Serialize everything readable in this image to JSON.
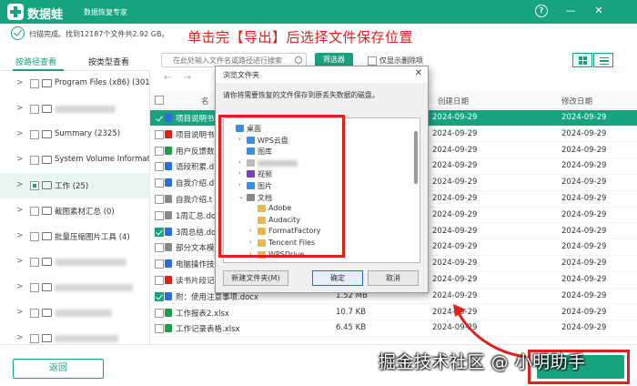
{
  "app": {
    "name": "数据蛙",
    "subtitle": "数据恢复专家"
  },
  "window_controls": {
    "help": "?",
    "minimize": "—",
    "close": "✕"
  },
  "status": {
    "text": "扫描完成。找到12187个文件共2.92 GB。"
  },
  "annotation": {
    "title": "单击完【导出】后选择文件保存位置",
    "watermark": "掘金技术社区 @ 小明助手"
  },
  "tabs": [
    {
      "label": "按路径查看"
    },
    {
      "label": "按类型查看"
    }
  ],
  "search": {
    "placeholder": "在此处输入文件名或路径进行搜索"
  },
  "toolbar": {
    "filter": "筛选器",
    "show_deleted": "仅显示删除项"
  },
  "tree": [
    {
      "label": "Program Files (x86) (3010",
      "blurred": false
    },
    {
      "label": "",
      "blurred": true
    },
    {
      "label": "Summary (2325)",
      "blurred": false
    },
    {
      "label": "System Volume Informati",
      "blurred": false
    },
    {
      "label": "工作 (25)",
      "blurred": false,
      "selected": true
    },
    {
      "label": "截图素材汇总 (0)",
      "blurred": false
    },
    {
      "label": "批量压缩图片工具 (4)",
      "blurred": false
    },
    {
      "label": "",
      "blurred": true
    },
    {
      "label": "",
      "blurred": true
    },
    {
      "label": "",
      "blurred": true
    },
    {
      "label": "",
      "blurred": true
    }
  ],
  "table": {
    "headers": {
      "name": "名",
      "created": "创建日期",
      "modified": "修改日期"
    },
    "rows": [
      {
        "name": "项目说明书",
        "size": "",
        "created": "2024-09-29",
        "modified": "2024-09-29",
        "checked": true,
        "selected": true,
        "color": "#2b6fd6"
      },
      {
        "name": "项目说明书",
        "size": "",
        "created": "2024-09-29",
        "modified": "2024-09-29",
        "checked": false,
        "color": "#e0201c"
      },
      {
        "name": "用户反馈数",
        "size": "",
        "created": "2024-09-29",
        "modified": "2024-09-29",
        "checked": false,
        "color": "#1e9e4a"
      },
      {
        "name": "语段积累.d",
        "size": "",
        "created": "2024-09-29",
        "modified": "2024-09-29",
        "checked": false,
        "color": "#2b6fd6"
      },
      {
        "name": "自我介绍.d",
        "size": "",
        "created": "2024-09-29",
        "modified": "2024-09-29",
        "checked": false,
        "color": "#2b6fd6"
      },
      {
        "name": "自我介绍.t",
        "size": "",
        "created": "2024-09-29",
        "modified": "2024-09-29",
        "checked": false,
        "color": "#888"
      },
      {
        "name": "1周汇总.do",
        "size": "",
        "created": "2024-09-29",
        "modified": "2024-09-29",
        "checked": false,
        "color": "#888"
      },
      {
        "name": "3周总结.do",
        "size": "",
        "created": "2024-09-29",
        "modified": "2024-09-29",
        "checked": true,
        "color": "#2b6fd6"
      },
      {
        "name": "部分文本模",
        "size": "",
        "created": "2024-09-29",
        "modified": "2024-09-29",
        "checked": false,
        "color": "#888"
      },
      {
        "name": "电脑操作技",
        "size": "",
        "created": "2024-09-29",
        "modified": "2024-09-29",
        "checked": false,
        "color": "#2b6fd6"
      },
      {
        "name": "读书片段记",
        "size": "",
        "created": "2024-09-29",
        "modified": "2024-09-29",
        "checked": false,
        "color": "#e0201c"
      },
      {
        "name": "附：使用注意事项.docx",
        "size": "1.52 MB",
        "created": "2024-09-29",
        "modified": "2024-09-29",
        "checked": true,
        "color": "#2b6fd6"
      },
      {
        "name": "工作报表2.xlsx",
        "size": "10.7 KB",
        "created": "2024-09-29",
        "modified": "2024-09-29",
        "checked": false,
        "color": "#1e9e4a"
      },
      {
        "name": "工作记录表格.xlsx",
        "size": "6.45 KB",
        "created": "2024-09-29",
        "modified": "2024-09-29",
        "checked": false,
        "color": "#1e9e4a"
      }
    ]
  },
  "dialog": {
    "title": "浏览文件夹",
    "message": "请你将需要恢复的文件保存到原丢失数据的磁盘。",
    "tree": [
      {
        "label": "桌面",
        "toggle": "",
        "indent": 0,
        "icon": "desktop-icon",
        "color": "#3a8ee6"
      },
      {
        "label": "WPS云盘",
        "toggle": "›",
        "indent": 1,
        "icon": "cloud-icon",
        "color": "#3a8ee6"
      },
      {
        "label": "图库",
        "toggle": "",
        "indent": 1,
        "icon": "gallery-icon",
        "color": "#3a8ee6"
      },
      {
        "label": "",
        "toggle": "›",
        "indent": 1,
        "icon": "user-icon",
        "color": "#bbb",
        "blurred": true
      },
      {
        "label": "视频",
        "toggle": "›",
        "indent": 1,
        "icon": "video-icon",
        "color": "#7b3fc4"
      },
      {
        "label": "图片",
        "toggle": "›",
        "indent": 1,
        "icon": "picture-icon",
        "color": "#3a8ee6"
      },
      {
        "label": "文档",
        "toggle": "⌄",
        "indent": 1,
        "icon": "document-icon",
        "color": "#888"
      },
      {
        "label": "Adobe",
        "toggle": "",
        "indent": 2,
        "icon": "folder-icon",
        "color": "#e8b84a"
      },
      {
        "label": "Audacity",
        "toggle": "",
        "indent": 2,
        "icon": "folder-icon",
        "color": "#e8b84a"
      },
      {
        "label": "FormatFactory",
        "toggle": "›",
        "indent": 2,
        "icon": "folder-icon",
        "color": "#e8b84a"
      },
      {
        "label": "Tencent Files",
        "toggle": "›",
        "indent": 2,
        "icon": "folder-icon",
        "color": "#e8b84a"
      },
      {
        "label": "WPSDrive",
        "toggle": "›",
        "indent": 2,
        "icon": "folder-icon",
        "color": "#e8b84a"
      }
    ],
    "new_folder": "新建文件夹(M)",
    "ok": "确定",
    "cancel": "取消"
  },
  "bottom": {
    "back": "返回"
  },
  "colors": {
    "brand": "#17a37f",
    "annotation_red": "#e0201c"
  }
}
